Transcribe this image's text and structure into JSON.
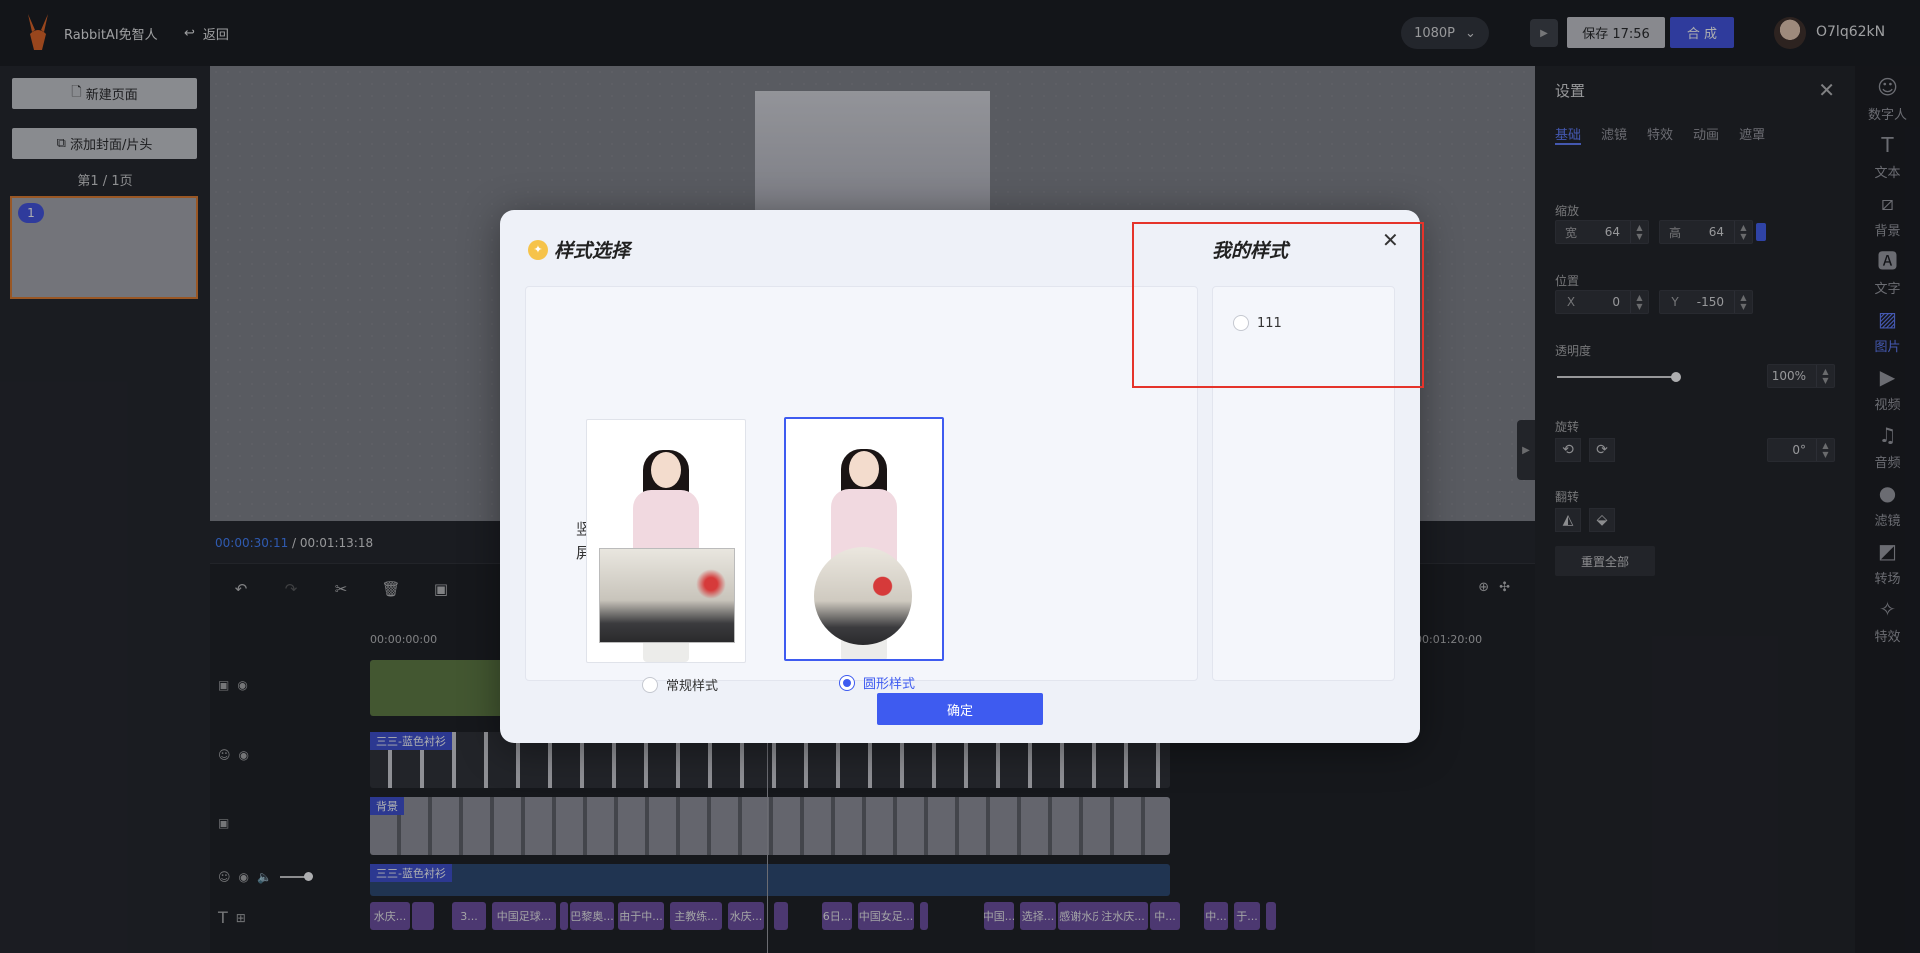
{
  "header": {
    "brand": "RabbitAI免智人",
    "back_label": "返回",
    "resolution": "1080P",
    "save_label": "保存 17:56",
    "compose_label": "合 成",
    "username": "O7lq62kN"
  },
  "left_panel": {
    "new_page_label": "新建页面",
    "add_cover_label": "添加封面/片头",
    "page_info": "第1 / 1页",
    "thumb_number": "1"
  },
  "timecode": {
    "current": "00:00:30:11",
    "total": "/ 00:01:13:18"
  },
  "timeline": {
    "ruler_start": "00:00:00:00",
    "ruler_end": "00:01:20:00",
    "track_labels": {
      "avatar": "三三-蓝色衬衫",
      "background": "背景",
      "audio": "三三-蓝色衬衫"
    },
    "subtitle_chips": [
      "水庆...",
      "",
      "3...",
      "中国足球...",
      "",
      "巴黎奥...",
      "由于中...",
      "主教练...",
      "水庆...",
      "",
      "6日...",
      "中国女足...",
      "",
      "中国...",
      "选择...",
      "感谢水庆商...",
      "注水庆...",
      "中...",
      "中...",
      "于...",
      ""
    ]
  },
  "settings": {
    "title": "设置",
    "tabs": [
      "基础",
      "滤镜",
      "特效",
      "动画",
      "遮罩"
    ],
    "scale_label": "缩放",
    "width_label": "宽",
    "width_value": "64",
    "height_label": "高",
    "height_value": "64",
    "position_label": "位置",
    "x_label": "X",
    "x_value": "0",
    "y_label": "Y",
    "y_value": "-150",
    "opacity_label": "透明度",
    "opacity_value": "100%",
    "opacity_level": 1.0,
    "rotate_label": "旋转",
    "rotate_value": "0°",
    "flip_label": "翻转",
    "reset_label": "重置全部"
  },
  "rail": [
    {
      "label": "数字人",
      "icon": "digital-human-icon"
    },
    {
      "label": "文本",
      "icon": "text-icon"
    },
    {
      "label": "背景",
      "icon": "background-icon"
    },
    {
      "label": "文字",
      "icon": "font-icon"
    },
    {
      "label": "图片",
      "icon": "image-icon"
    },
    {
      "label": "视频",
      "icon": "video-icon"
    },
    {
      "label": "音频",
      "icon": "audio-icon"
    },
    {
      "label": "滤镜",
      "icon": "filter-icon"
    },
    {
      "label": "转场",
      "icon": "transition-icon"
    },
    {
      "label": "特效",
      "icon": "effect-icon"
    }
  ],
  "modal": {
    "title": "样式选择",
    "my_styles_title": "我的样式",
    "orientation": "竖屏",
    "style_options": [
      {
        "label": "常规样式",
        "selected": false
      },
      {
        "label": "圆形样式",
        "selected": true
      }
    ],
    "my_styles": [
      {
        "label": "111",
        "selected": false
      }
    ],
    "confirm_label": "确定"
  },
  "colors": {
    "accent": "#3e5bf0",
    "highlight_box": "#e5332a",
    "thumb_border": "#e07a2a"
  }
}
